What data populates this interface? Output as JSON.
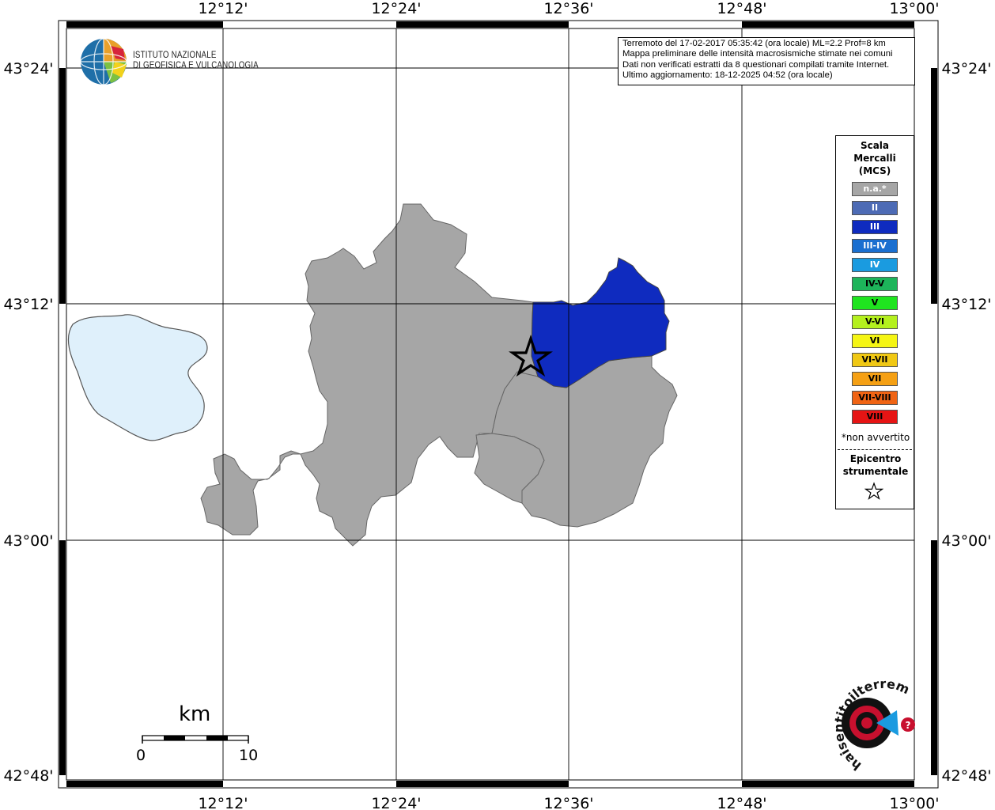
{
  "axes": {
    "lon_ticks": [
      "12°12'",
      "12°24'",
      "12°36'",
      "12°48'",
      "13°00'"
    ],
    "lat_ticks": [
      "43°24'",
      "43°12'",
      "43°00'",
      "42°48'"
    ]
  },
  "info": {
    "line1": "Terremoto del 17-02-2017 05:35:42 (ora locale) ML=2.2 Prof=8 km",
    "line2": "Mappa preliminare delle intensità macrosismiche stimate nei comuni",
    "line3": "Dati non verificati estratti da 8 questionari compilati tramite Internet.",
    "line4": "Ultimo aggiornamento: 18-12-2025 04:52 (ora locale)"
  },
  "logo": {
    "line1": "ISTITUTO NAZIONALE",
    "line2": "DI GEOFISICA E VULCANOLOGIA"
  },
  "legend": {
    "title1": "Scala",
    "title2": "Mercalli",
    "title3": "(MCS)",
    "classes": [
      {
        "label": "n.a.*",
        "color": "#a6a6a6",
        "text_color": "#ffffff"
      },
      {
        "label": "II",
        "color": "#4d6bb5",
        "text_color": "#ffffff"
      },
      {
        "label": "III",
        "color": "#0f2bbf",
        "text_color": "#ffffff"
      },
      {
        "label": "III-IV",
        "color": "#1a6fd0",
        "text_color": "#ffffff"
      },
      {
        "label": "IV",
        "color": "#1a9be0",
        "text_color": "#ffffff"
      },
      {
        "label": "IV-V",
        "color": "#1db45a",
        "text_color": "#000000"
      },
      {
        "label": "V",
        "color": "#1fe41f",
        "text_color": "#000000"
      },
      {
        "label": "V-VI",
        "color": "#b4f01e",
        "text_color": "#000000"
      },
      {
        "label": "VI",
        "color": "#f5f514",
        "text_color": "#000000"
      },
      {
        "label": "VI-VII",
        "color": "#f0c814",
        "text_color": "#000000"
      },
      {
        "label": "VII",
        "color": "#f5a014",
        "text_color": "#000000"
      },
      {
        "label": "VII-VIII",
        "color": "#f06414",
        "text_color": "#000000"
      },
      {
        "label": "VIII",
        "color": "#e61414",
        "text_color": "#000000"
      }
    ],
    "note": "*non avvertito",
    "epicenter1": "Epicentro",
    "epicenter2": "strumentale"
  },
  "scale_bar": {
    "unit": "km",
    "min": "0",
    "max": "10"
  },
  "colors": {
    "not_felt": "#a6a6a6",
    "intensity_III": "#0f2bbf",
    "lake": "#dff0fb"
  },
  "watermark": {
    "text": "haisentitoilterremoto.it"
  }
}
